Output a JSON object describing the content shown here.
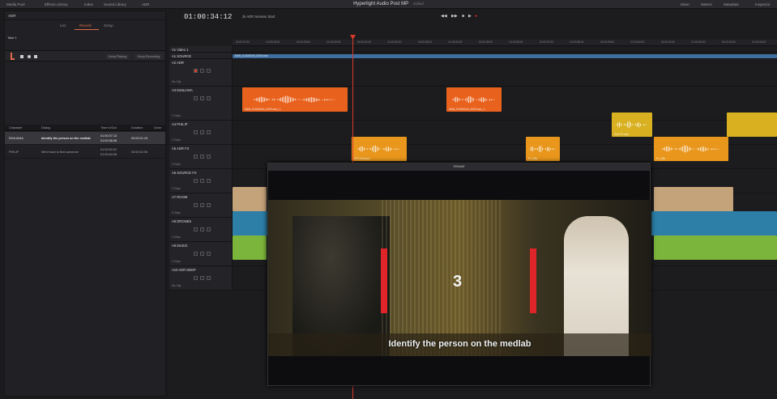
{
  "topbar": {
    "items": [
      "Media Pool",
      "Effects Library",
      "Index",
      "Sound Library",
      "ADR"
    ],
    "right_items": [
      "Mixer",
      "Meters",
      "Metadata",
      "Inspector"
    ]
  },
  "window": {
    "title": "Hyperlight Audio Post MP",
    "subtitle": "Edited"
  },
  "left_panel": {
    "header": "ADR",
    "tabs": [
      "List",
      "Record",
      "Setup"
    ],
    "active_tab": "Record",
    "record_label": "Take 1",
    "play_buttons": [
      "Keep Playing",
      "Keep Recording"
    ],
    "cue_columns": [
      "Character",
      "Dialog",
      "Time In/Out",
      "Duration",
      "Done"
    ],
    "cues": [
      {
        "character": "EMILIANA",
        "dialog": "Identify the person on the medlab",
        "time_in": "01:00:37:13",
        "time_out": "01:00:38:08",
        "duration": "00:00:01:15",
        "selected": true
      },
      {
        "character": "PHILIP",
        "dialog": "We'd have to find someone",
        "time_in": "01:00:52:02",
        "time_out": "01:00:54:08",
        "duration": "00:00:02:06",
        "selected": false
      }
    ]
  },
  "timeline": {
    "timecode": "01:00:34:12",
    "session_label": "2k ADR Session Start",
    "ruler_marks": [
      "01:00:27:00",
      "01:00:28:00",
      "01:00:29:00",
      "01:00:30:00",
      "01:00:31:00",
      "01:00:32:00",
      "01:00:33:00",
      "01:00:34:00",
      "01:00:35:00",
      "01:00:36:00",
      "01:00:37:00",
      "01:00:38:00",
      "01:00:39:00",
      "01:00:40:00",
      "01:00:41:00",
      "01:00:42:00",
      "01:00:43:00",
      "01:00:44:00"
    ],
    "tracks": [
      {
        "id": "V1",
        "name": "Video 1",
        "sub": ""
      },
      {
        "id": "A1",
        "name": "SOURCE",
        "sub": ""
      },
      {
        "id": "A2",
        "name": "ADR",
        "sub": "No Clip"
      },
      {
        "id": "A3",
        "name": "EMILIANA",
        "sub": "2 Clips"
      },
      {
        "id": "A4",
        "name": "PHILIP",
        "sub": "2 Clips"
      },
      {
        "id": "A5",
        "name": "ADR FX",
        "sub": "3 Clips"
      },
      {
        "id": "A6",
        "name": "SOURCE FX",
        "sub": "2 Clips"
      },
      {
        "id": "A7",
        "name": "ROOM",
        "sub": "5 Clips"
      },
      {
        "id": "A8",
        "name": "DRONES",
        "sub": "4 Clips"
      },
      {
        "id": "A9",
        "name": "MUSIC",
        "sub": "2 Clips"
      },
      {
        "id": "A10",
        "name": "ADR DEEP",
        "sub": "No Clip"
      }
    ],
    "clip_labels": {
      "video": "MAN_S10A0045_0000.mov",
      "emil1": "MAN_S10A0044_0000.mov_1",
      "emil2": "MAN_S10A0044_0000.mov_1",
      "phil1": "Sub-FX.wav",
      "adrfx1": "SFX-Whoosh",
      "adrfx2": "Fx_06a",
      "adrfx3": "Fx_06b"
    }
  },
  "viewer": {
    "title": "Viewer",
    "countdown": "3",
    "subtitle": "Identify the person on the medlab"
  },
  "colors": {
    "accent": "#e06a4a",
    "playhead": "#d83a2c",
    "emiliana": "#e8621e",
    "philip": "#d8b020",
    "adrfx": "#e8961c",
    "room": "#c4a27a",
    "drones": "#2d7fa8",
    "music": "#7cb53c",
    "streamer": "#e0252a"
  }
}
